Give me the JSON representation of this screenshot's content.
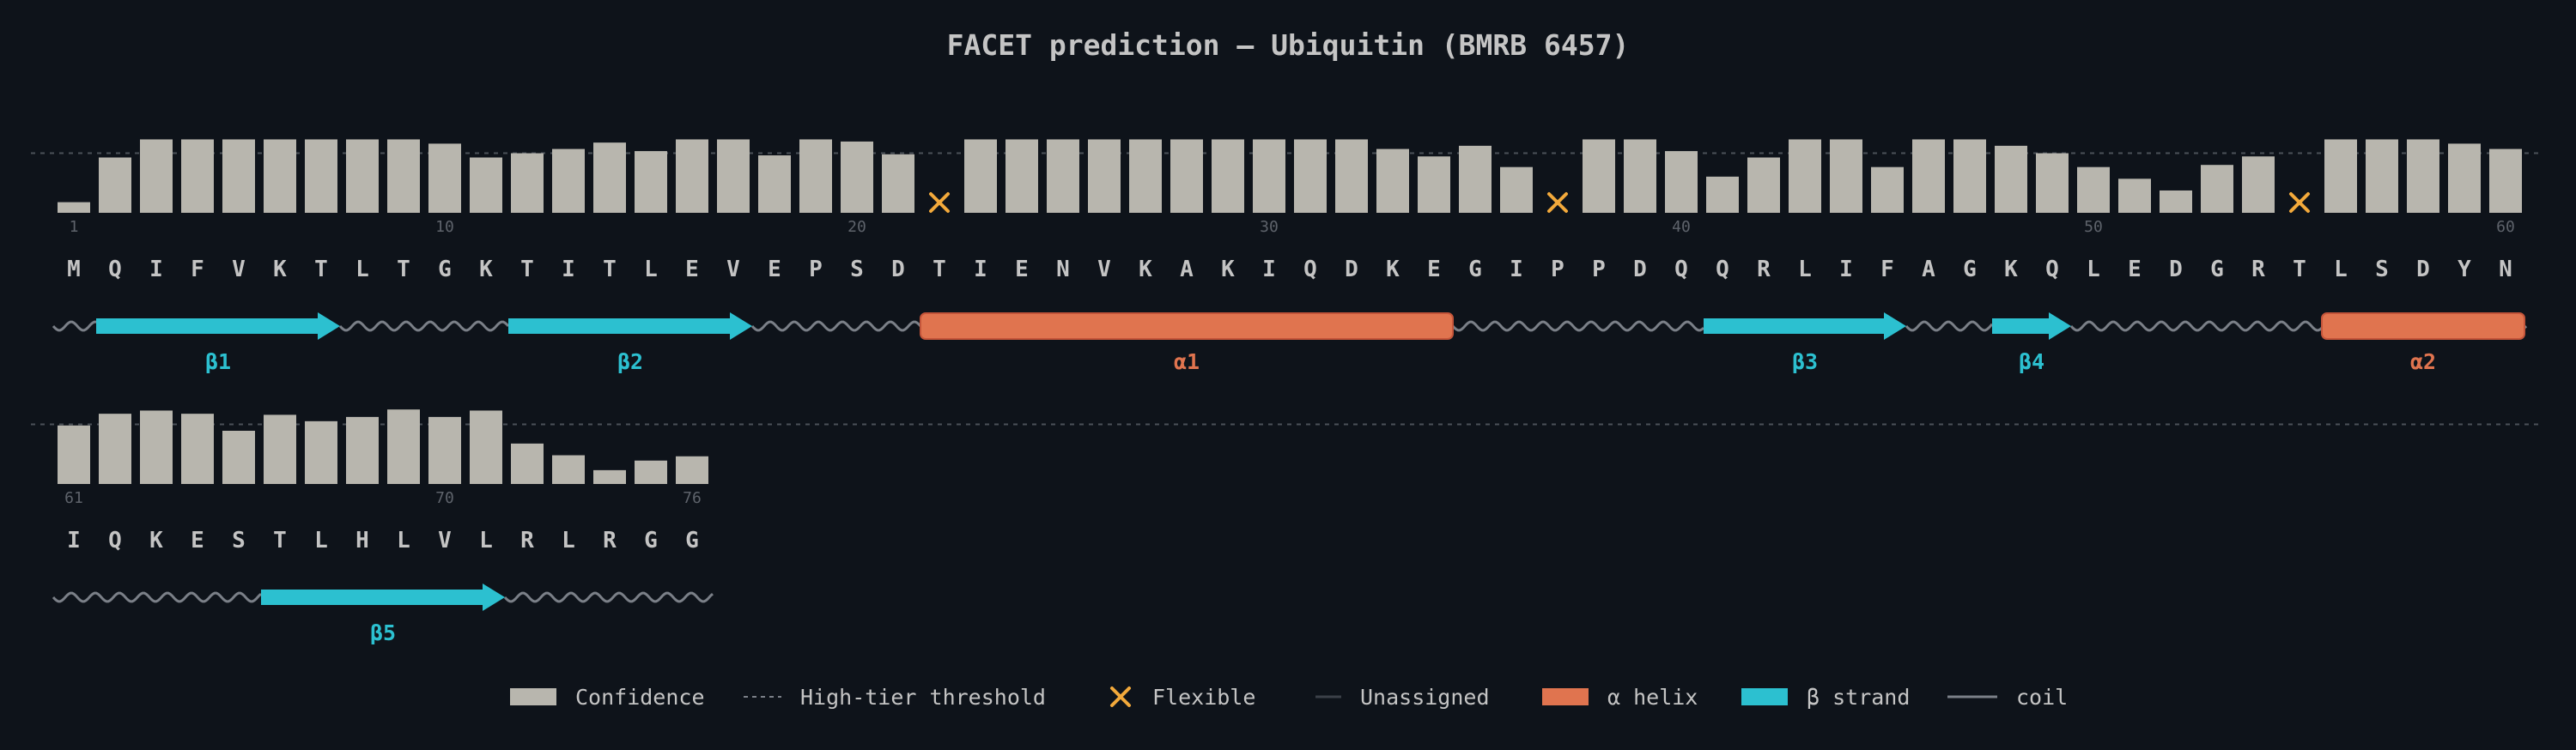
{
  "chart_data": {
    "type": "bar",
    "title": "FACET prediction — Ubiquitin (BMRB 6457)",
    "ylim": [
      0,
      1
    ],
    "threshold": 0.56,
    "residues": [
      "M",
      "Q",
      "I",
      "F",
      "V",
      "K",
      "T",
      "L",
      "T",
      "G",
      "K",
      "T",
      "I",
      "T",
      "L",
      "E",
      "V",
      "E",
      "P",
      "S",
      "D",
      "T",
      "I",
      "E",
      "N",
      "V",
      "K",
      "A",
      "K",
      "I",
      "Q",
      "D",
      "K",
      "E",
      "G",
      "I",
      "P",
      "P",
      "D",
      "Q",
      "Q",
      "R",
      "L",
      "I",
      "F",
      "A",
      "G",
      "K",
      "Q",
      "L",
      "E",
      "D",
      "G",
      "R",
      "T",
      "L",
      "S",
      "D",
      "Y",
      "N",
      "I",
      "Q",
      "K",
      "E",
      "S",
      "T",
      "L",
      "H",
      "L",
      "V",
      "L",
      "R",
      "L",
      "R",
      "G",
      "G"
    ],
    "confidence": [
      0.1,
      0.52,
      0.69,
      0.69,
      0.69,
      0.69,
      0.69,
      0.69,
      0.69,
      0.65,
      0.52,
      0.56,
      0.6,
      0.66,
      0.58,
      0.69,
      0.69,
      0.54,
      0.69,
      0.67,
      0.55,
      null,
      0.69,
      0.69,
      0.69,
      0.69,
      0.69,
      0.69,
      0.69,
      0.69,
      0.69,
      0.69,
      0.6,
      0.53,
      0.63,
      0.43,
      null,
      0.69,
      0.69,
      0.58,
      0.34,
      0.52,
      0.69,
      0.69,
      0.43,
      0.69,
      0.69,
      0.63,
      0.56,
      0.43,
      0.32,
      0.21,
      0.45,
      0.53,
      null,
      0.69,
      0.69,
      0.69,
      0.65,
      0.6,
      0.55,
      0.66,
      0.69,
      0.66,
      0.5,
      0.65,
      0.59,
      0.63,
      0.7,
      0.63,
      0.69,
      0.38,
      0.27,
      0.13,
      0.22,
      0.26
    ],
    "flexible": [
      22,
      37,
      55
    ],
    "tick_labels": [
      "1",
      "10",
      "20",
      "30",
      "40",
      "50",
      "60",
      "61",
      "70",
      "76"
    ],
    "secondary_structure": [
      {
        "type": "strand",
        "label": "β1",
        "start": 2,
        "end": 7
      },
      {
        "type": "strand",
        "label": "β2",
        "start": 12,
        "end": 17
      },
      {
        "type": "helix",
        "label": "α1",
        "start": 22,
        "end": 34
      },
      {
        "type": "strand",
        "label": "β3",
        "start": 41,
        "end": 45
      },
      {
        "type": "strand",
        "label": "β4",
        "start": 48,
        "end": 49
      },
      {
        "type": "helix",
        "label": "α2",
        "start": 56,
        "end": 60
      },
      {
        "type": "strand",
        "label": "β5",
        "start": 66,
        "end": 71
      }
    ],
    "legend": [
      {
        "key": "confidence",
        "label": "Confidence"
      },
      {
        "key": "threshold",
        "label": "High-tier threshold"
      },
      {
        "key": "flexible",
        "label": "Flexible"
      },
      {
        "key": "unassigned",
        "label": "Unassigned"
      },
      {
        "key": "helix",
        "label": "α helix"
      },
      {
        "key": "strand",
        "label": "β strand"
      },
      {
        "key": "coil",
        "label": "coil"
      }
    ],
    "colors": {
      "background": "#0e131a",
      "bar": "#b8b6ae",
      "text": "#c4c4c4",
      "tick": "#5e636b",
      "threshold": "#4b5058",
      "flexible": "#f2a93b",
      "helix": "#e0744f",
      "helix_edge": "#c4553a",
      "strand": "#2cc0d0",
      "coil": "#7b8088",
      "unassigned": "#3b4048"
    }
  }
}
